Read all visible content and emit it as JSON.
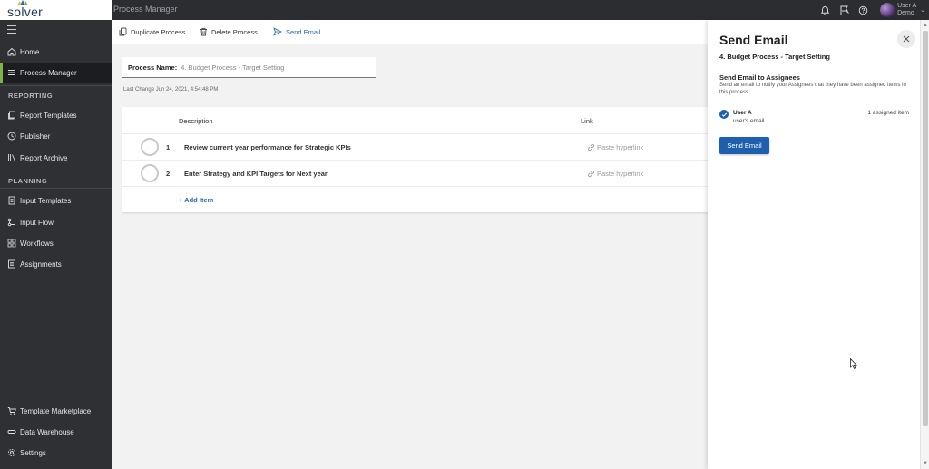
{
  "brand": {
    "logo_text": "solver"
  },
  "header": {
    "app_title": "Process Manager",
    "user_name": "User A",
    "user_org": "Demo",
    "icons": [
      "bell-icon",
      "chat-flag-icon",
      "help-icon",
      "chevron-down-icon"
    ]
  },
  "sidebar": {
    "items": [
      {
        "label": "Home",
        "icon": "home-icon"
      },
      {
        "label": "Process Manager",
        "icon": "list-sliders-icon",
        "active": true
      }
    ],
    "sections": [
      {
        "title": "REPORTING",
        "items": [
          {
            "label": "Report Templates",
            "icon": "report-templates-icon"
          },
          {
            "label": "Publisher",
            "icon": "clock-icon"
          },
          {
            "label": "Report Archive",
            "icon": "archive-icon"
          }
        ]
      },
      {
        "title": "PLANNING",
        "items": [
          {
            "label": "Input Templates",
            "icon": "document-icon"
          },
          {
            "label": "Input Flow",
            "icon": "flow-icon"
          },
          {
            "label": "Workflows",
            "icon": "grid-icon"
          },
          {
            "label": "Assignments",
            "icon": "checklist-icon"
          }
        ]
      }
    ],
    "bottom_items": [
      {
        "label": "Template Marketplace",
        "icon": "cart-icon"
      },
      {
        "label": "Data Warehouse",
        "icon": "database-icon"
      },
      {
        "label": "Settings",
        "icon": "gear-icon"
      }
    ]
  },
  "toolbar": {
    "duplicate_label": "Duplicate Process",
    "delete_label": "Delete Process",
    "send_email_label": "Send Email"
  },
  "process": {
    "name_label": "Process Name:",
    "name_value": "4. Budget Process - Target Setting",
    "last_change": "Last Change Jun 24, 2021, 4:54:48 PM"
  },
  "table": {
    "columns": {
      "description": "Description",
      "link": "Link"
    },
    "rows": [
      {
        "number": "1",
        "description": "Review current year performance for Strategic KPIs",
        "link_placeholder": "Paste hyperlink"
      },
      {
        "number": "2",
        "description": "Enter Strategy and KPI Targets for Next year",
        "link_placeholder": "Paste hyperlink"
      }
    ],
    "add_item_label": "+ Add Item"
  },
  "panel": {
    "title": "Send Email",
    "subtitle": "4. Budget Process - Target Setting",
    "section_title": "Send Email to Assignees",
    "description": "Send an email to notify your Assignees that they have been assigned items in this process.",
    "assignee": {
      "name": "User A",
      "email": "user's email",
      "count": "1 assigned item",
      "checked": true
    },
    "send_button_label": "Send Email"
  },
  "colors": {
    "accent_green": "#7cb342",
    "primary_blue": "#1e5fae",
    "link_blue": "#2b6cb0",
    "sidebar_bg": "#2e3033"
  }
}
